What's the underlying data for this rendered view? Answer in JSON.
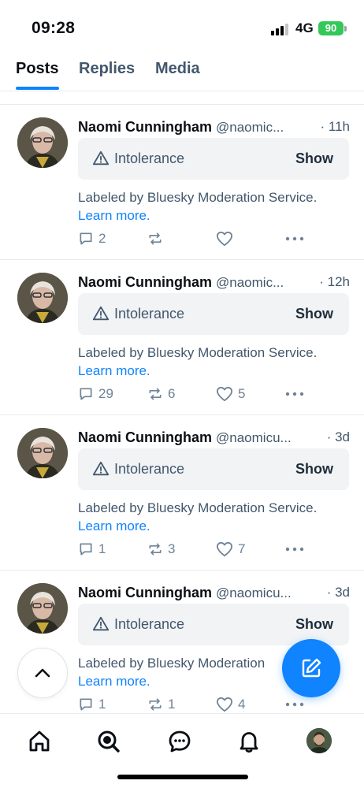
{
  "status_bar": {
    "time": "09:28",
    "network": "4G",
    "battery": "90"
  },
  "tabs": [
    {
      "label": "Posts",
      "active": true
    },
    {
      "label": "Replies",
      "active": false
    },
    {
      "label": "Media",
      "active": false
    }
  ],
  "posts": [
    {
      "author": "Naomi Cunningham",
      "handle": "@naomic...",
      "time": "· 11h",
      "label": "Intolerance",
      "show": "Show",
      "moderation": "Labeled by Bluesky Moderation Service.",
      "learn_more": "Learn more.",
      "replies": "2",
      "reposts": "",
      "likes": ""
    },
    {
      "author": "Naomi Cunningham",
      "handle": "@naomic...",
      "time": "· 12h",
      "label": "Intolerance",
      "show": "Show",
      "moderation": "Labeled by Bluesky Moderation Service.",
      "learn_more": "Learn more.",
      "replies": "29",
      "reposts": "6",
      "likes": "5"
    },
    {
      "author": "Naomi Cunningham",
      "handle": "@naomicu...",
      "time": "· 3d",
      "label": "Intolerance",
      "show": "Show",
      "moderation": "Labeled by Bluesky Moderation Service.",
      "learn_more": "Learn more.",
      "replies": "1",
      "reposts": "3",
      "likes": "7"
    },
    {
      "author": "Naomi Cunningham",
      "handle": "@naomicu...",
      "time": "· 3d",
      "label": "Intolerance",
      "show": "Show",
      "moderation": "Labeled by Bluesky Moderation",
      "learn_more": "Learn more.",
      "replies": "1",
      "reposts": "1",
      "likes": "4"
    }
  ],
  "icons": {
    "warning": "warning-triangle-icon",
    "reply": "reply-bubble-icon",
    "repost": "repost-icon",
    "like": "heart-icon",
    "more": "more-dots-icon",
    "scroll_top": "chevron-up-icon",
    "compose": "compose-icon",
    "nav": [
      "home-icon",
      "search-icon",
      "chat-icon",
      "bell-icon"
    ]
  },
  "colors": {
    "accent": "#1083fe",
    "battery": "#34c759"
  }
}
